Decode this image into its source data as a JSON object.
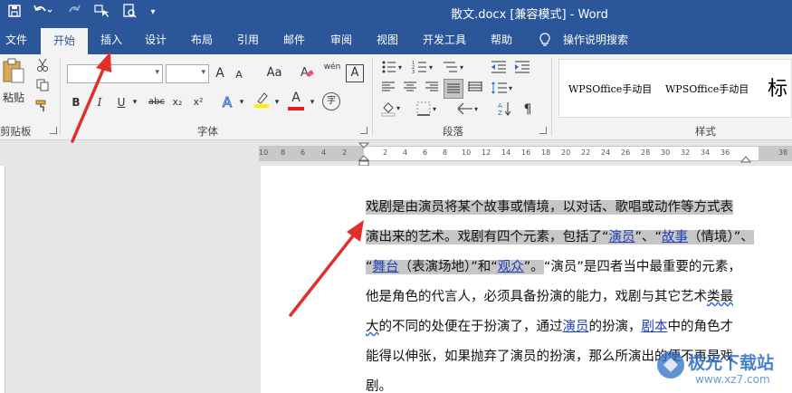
{
  "window": {
    "title": "散文.docx [兼容模式] - Word"
  },
  "qat": {
    "save_icon": "save-icon",
    "undo_icon": "undo-icon",
    "redo_icon": "redo-icon",
    "touch_icon": "touch-mode-icon",
    "preview_icon": "print-preview-icon",
    "customize_icon": "customize-qat-icon"
  },
  "tabs": [
    "文件",
    "开始",
    "插入",
    "设计",
    "布局",
    "引用",
    "邮件",
    "审阅",
    "视图",
    "开发工具",
    "帮助",
    "操作说明搜索"
  ],
  "ribbon": {
    "clipboard": {
      "paste_label": "粘贴",
      "group_label": "剪贴板"
    },
    "font": {
      "group_label": "字体",
      "grow": "A",
      "shrink": "A",
      "case": "Aa",
      "phonetic": "wén",
      "border_char": "A",
      "bold": "B",
      "italic": "I",
      "underline": "U",
      "strike": "abc",
      "sub": "x₂",
      "sup": "x²",
      "effects": "A",
      "fontcolor": "A",
      "circled": "字"
    },
    "paragraph": {
      "group_label": "段落"
    },
    "styles": {
      "group_label": "样式",
      "items": [
        "WPSOffice手动目",
        "WPSOffice手动目",
        "标"
      ]
    }
  },
  "ruler": {
    "ticks": [
      "10",
      "8",
      "6",
      "4",
      "2",
      "2",
      "4",
      "6",
      "8",
      "10",
      "12",
      "14",
      "16",
      "18",
      "20",
      "22",
      "24",
      "26",
      "28",
      "30",
      "32",
      "34",
      "36",
      "38"
    ]
  },
  "document": {
    "l1": "戏剧是由演员将某个故事或情境，以对话、歌唱或动作等方式表",
    "l2a": "演出来的艺术。戏剧有四个元素，包括了“",
    "l2b": "演员",
    "l2c": "”、“",
    "l2d": "故事",
    "l2e": "（情境）”、",
    "l3a": "“",
    "l3b": "舞台",
    "l3c": "（表演场地）”和“",
    "l3d": "观众",
    "l3e": "”。",
    "l3f": "“演员”是四者当中最重要的元素，",
    "l4a": "他是角色的代言人，必须具备扮演的能力，戏剧与其它艺术",
    "l4b": "类最",
    "l5a": "大",
    "l5b": "的不同的处便在于扮演了，通过",
    "l5c": "演员",
    "l5d": "的扮演，",
    "l5e": "剧本",
    "l5f": "中的角色才",
    "l6": "能得以伸张，如果抛弃了演员的扮演，那么所演出的便不再是戏",
    "l7": "剧。"
  },
  "watermark": {
    "text": "极光下载站",
    "sub": "www.xz7.com"
  },
  "colors": {
    "accent": "#2b579a",
    "arrow": "#e0302c",
    "selection": "#c6c6c6",
    "link": "#1f3fb8"
  }
}
